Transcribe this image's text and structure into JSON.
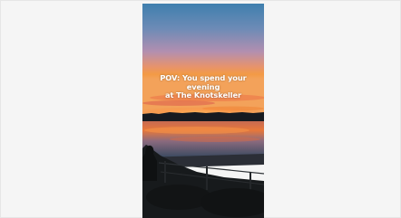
{
  "post": {
    "caption_line1": "POV: You spend your evening",
    "caption_line2": "at The Knotskeller"
  },
  "colors": {
    "page_background": "#f5f5f5",
    "sky_top": "#3f7fae",
    "sky_mid": "#9a8fb4",
    "sunset_glow": "#f08a3c",
    "water_orange": "#e8783a",
    "silhouette": "#171a1c"
  }
}
